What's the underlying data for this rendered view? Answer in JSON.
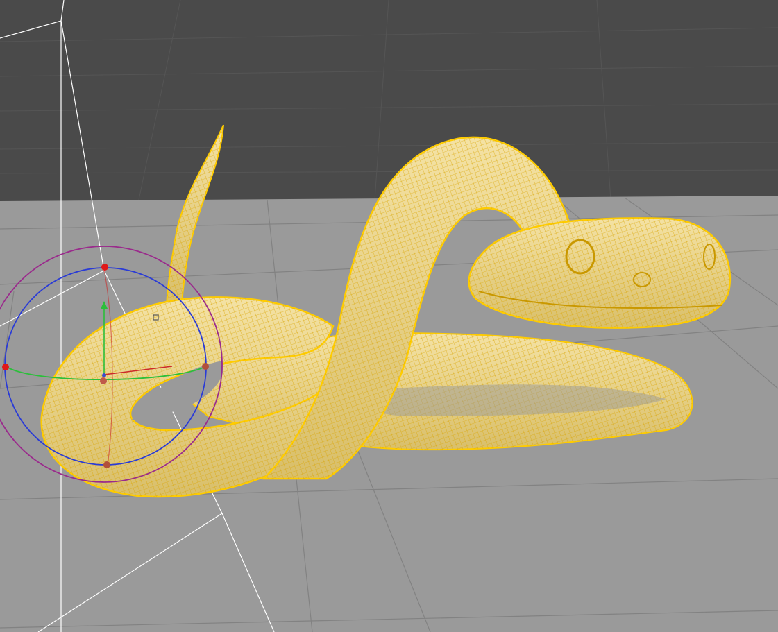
{
  "app": {
    "view": "3d-viewport-perspective"
  },
  "scene": {
    "background_color": "#4a4a4a",
    "floor_color": "#9a9a9a",
    "grid_line_color": "#828282",
    "far_grid_line_color": "#555555",
    "horizon_color": "#3f3f3f"
  },
  "selected_object": {
    "type": "snake-mesh",
    "state": "selected",
    "display": "wireframe-on-shaded",
    "wire_color": "#f2c21a",
    "body_color": "#efd893",
    "outline_color": "#ffd200"
  },
  "camera_frustum": {
    "visible": true,
    "line_color": "#ffffff"
  },
  "gizmo": {
    "type": "rotate",
    "active_handles": 4,
    "ring_colors": {
      "x": "#cc2a2a",
      "y": "#2bbf3a",
      "z": "#2a3bd6",
      "screen": "#9a2a8c"
    }
  }
}
